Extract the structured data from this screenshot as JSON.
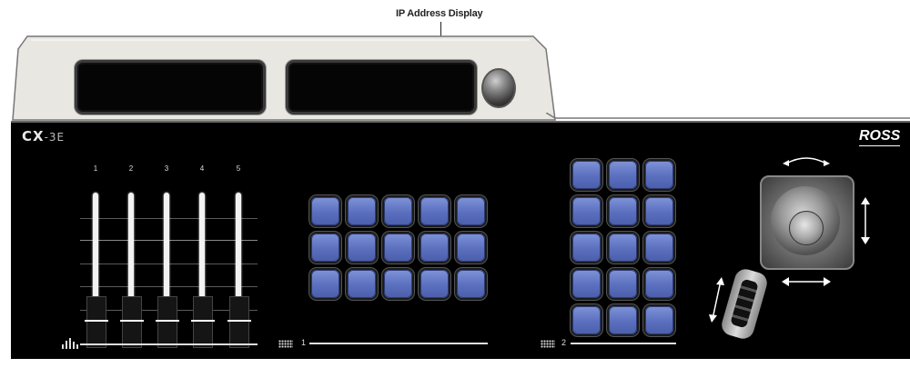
{
  "callout": {
    "label": "IP Address Display"
  },
  "brand": {
    "prefix": "CX",
    "model": "-3E",
    "maker": "ROSS"
  },
  "faders": {
    "labels": [
      "1",
      "2",
      "3",
      "4",
      "5"
    ]
  },
  "bank1": {
    "label": "1"
  },
  "bank2": {
    "label": "2"
  },
  "colors": {
    "button": "#6a7fcc",
    "panel": "#000000",
    "hood": "#e9e7e2"
  }
}
